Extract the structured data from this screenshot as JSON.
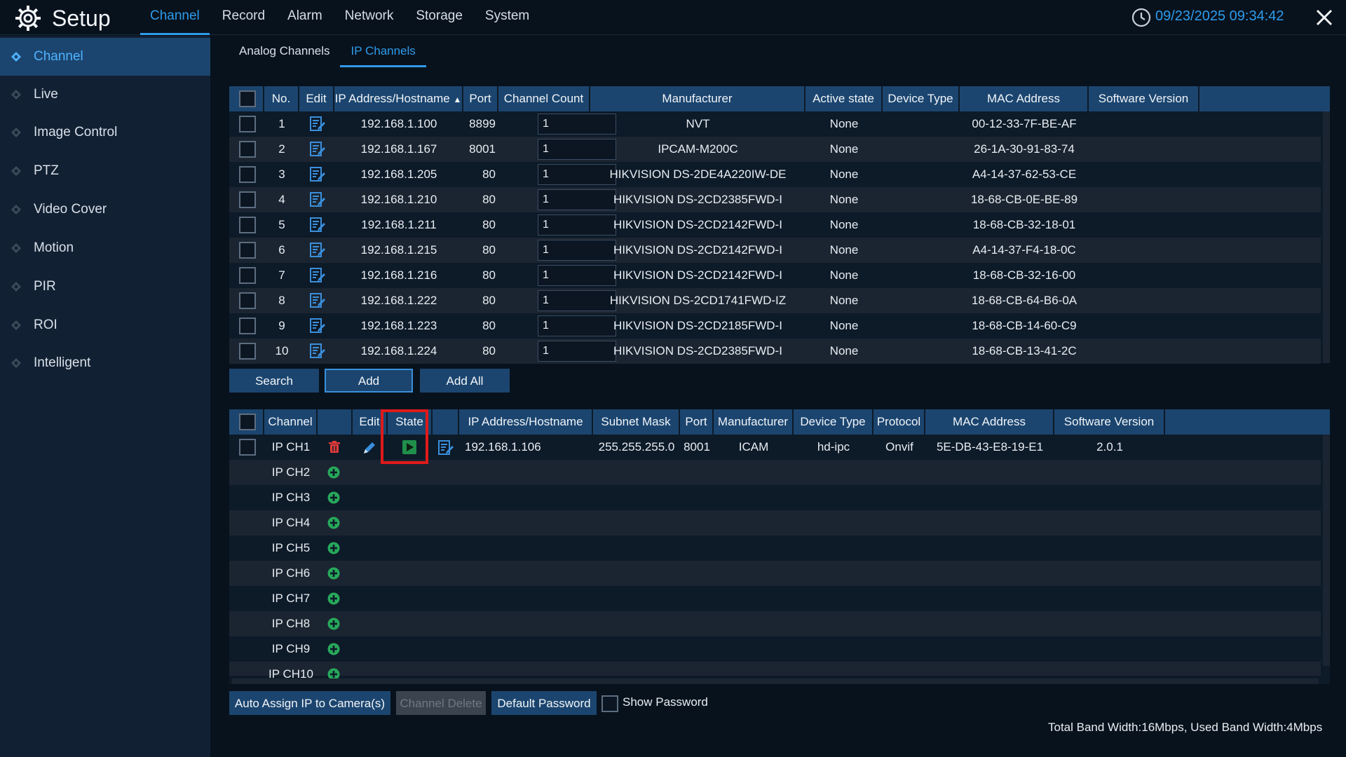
{
  "header": {
    "title": "Setup",
    "menu": [
      "Channel",
      "Record",
      "Alarm",
      "Network",
      "Storage",
      "System"
    ],
    "active_menu": "Channel",
    "datetime": "09/23/2025 09:34:42",
    "accent_color": "#2f9bea"
  },
  "sidebar": {
    "items": [
      {
        "label": "Channel",
        "active": true
      },
      {
        "label": "Live"
      },
      {
        "label": "Image Control"
      },
      {
        "label": "PTZ"
      },
      {
        "label": "Video Cover"
      },
      {
        "label": "Motion"
      },
      {
        "label": "PIR"
      },
      {
        "label": "ROI"
      },
      {
        "label": "Intelligent"
      }
    ]
  },
  "subtabs": [
    "Analog Channels",
    "IP Channels"
  ],
  "active_subtab": "IP Channels",
  "search_table": {
    "headers": [
      "No.",
      "Edit",
      "IP Address/Hostname",
      "Port",
      "Channel Count",
      "Manufacturer",
      "Active state",
      "Device Type",
      "MAC Address",
      "Software Version"
    ],
    "sort_indicator": "▲",
    "rows": [
      {
        "no": "1",
        "ip": "192.168.1.100",
        "port": "8899",
        "count": "1",
        "manufacturer": "NVT",
        "state": "None",
        "mac": "00-12-33-7F-BE-AF"
      },
      {
        "no": "2",
        "ip": "192.168.1.167",
        "port": "8001",
        "count": "1",
        "manufacturer": "IPCAM-M200C",
        "state": "None",
        "mac": "26-1A-30-91-83-74"
      },
      {
        "no": "3",
        "ip": "192.168.1.205",
        "port": "80",
        "count": "1",
        "manufacturer": "HIKVISION DS-2DE4A220IW-DE",
        "state": "None",
        "mac": "A4-14-37-62-53-CE"
      },
      {
        "no": "4",
        "ip": "192.168.1.210",
        "port": "80",
        "count": "1",
        "manufacturer": "HIKVISION DS-2CD2385FWD-I",
        "state": "None",
        "mac": "18-68-CB-0E-BE-89"
      },
      {
        "no": "5",
        "ip": "192.168.1.211",
        "port": "80",
        "count": "1",
        "manufacturer": "HIKVISION DS-2CD2142FWD-I",
        "state": "None",
        "mac": "18-68-CB-32-18-01"
      },
      {
        "no": "6",
        "ip": "192.168.1.215",
        "port": "80",
        "count": "1",
        "manufacturer": "HIKVISION DS-2CD2142FWD-I",
        "state": "None",
        "mac": "A4-14-37-F4-18-0C"
      },
      {
        "no": "7",
        "ip": "192.168.1.216",
        "port": "80",
        "count": "1",
        "manufacturer": "HIKVISION DS-2CD2142FWD-I",
        "state": "None",
        "mac": "18-68-CB-32-16-00"
      },
      {
        "no": "8",
        "ip": "192.168.1.222",
        "port": "80",
        "count": "1",
        "manufacturer": "HIKVISION DS-2CD1741FWD-IZ",
        "state": "None",
        "mac": "18-68-CB-64-B6-0A"
      },
      {
        "no": "9",
        "ip": "192.168.1.223",
        "port": "80",
        "count": "1",
        "manufacturer": "HIKVISION DS-2CD2185FWD-I",
        "state": "None",
        "mac": "18-68-CB-14-60-C9"
      },
      {
        "no": "10",
        "ip": "192.168.1.224",
        "port": "80",
        "count": "1",
        "manufacturer": "HIKVISION DS-2CD2385FWD-I",
        "state": "None",
        "mac": "18-68-CB-13-41-2C"
      }
    ]
  },
  "search_buttons": {
    "search": "Search",
    "add": "Add",
    "add_all": "Add All"
  },
  "channel_table": {
    "headers": [
      "Channel",
      "Edit",
      "State",
      "IP Address/Hostname",
      "Subnet Mask",
      "Port",
      "Manufacturer",
      "Device Type",
      "Protocol",
      "MAC Address",
      "Software Version"
    ],
    "added": {
      "channel": "IP CH1",
      "ip": "192.168.1.106",
      "subnet": "255.255.255.0",
      "port": "8001",
      "manufacturer": "ICAM",
      "device_type": "hd-ipc",
      "protocol": "Onvif",
      "mac": "5E-DB-43-E8-19-E1",
      "software": "2.0.1"
    },
    "empty_channels": [
      "IP CH2",
      "IP CH3",
      "IP CH4",
      "IP CH5",
      "IP CH6",
      "IP CH7",
      "IP CH8",
      "IP CH9",
      "IP CH10"
    ]
  },
  "bottom_buttons": {
    "auto_assign": "Auto Assign IP to Camera(s)",
    "channel_delete": "Channel Delete",
    "default_password": "Default Password",
    "show_password": "Show Password"
  },
  "bandwidth": "Total Band Width:16Mbps, Used Band Width:4Mbps",
  "colors": {
    "delete": "#e03a3a",
    "add": "#27a85a",
    "play": "#27a85a",
    "edit": "#3a8fdc",
    "highlight": "#e01a1a"
  }
}
